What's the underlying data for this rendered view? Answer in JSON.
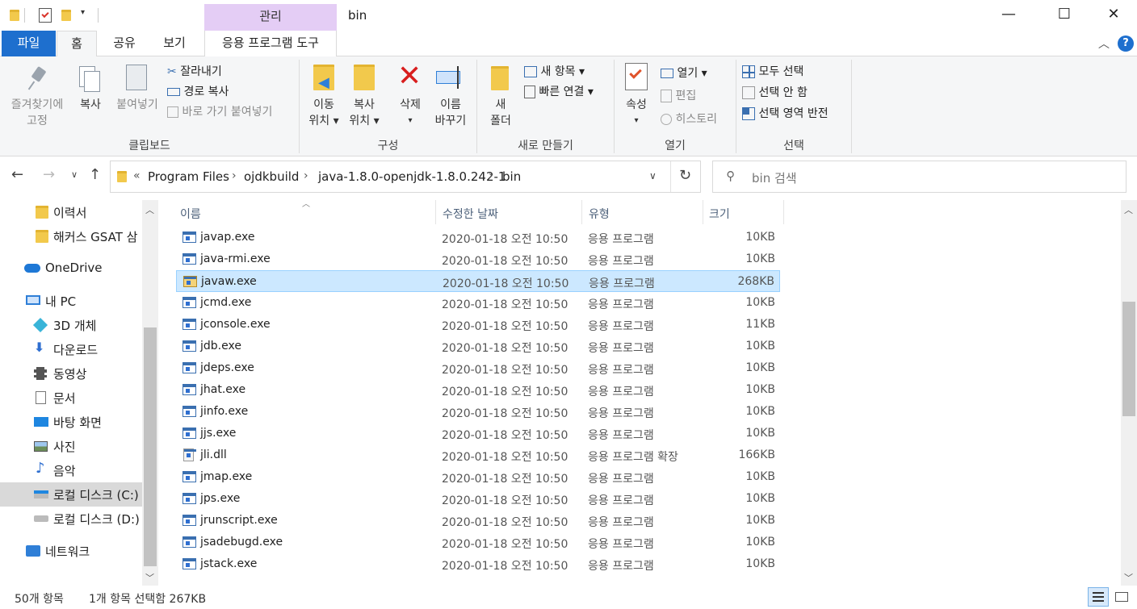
{
  "window": {
    "title": "bin",
    "context_tab": "관리",
    "minimize": "—",
    "maximize": "☐",
    "close": "✕"
  },
  "tabs": {
    "file": "파일",
    "home": "홈",
    "share": "공유",
    "view": "보기",
    "app_tools": "응용 프로그램 도구"
  },
  "ribbon": {
    "clipboard": {
      "label": "클립보드",
      "pin_line1": "즐겨찾기에",
      "pin_line2": "고정",
      "copy": "복사",
      "paste": "붙여넣기",
      "cut": "잘라내기",
      "copy_path": "경로 복사",
      "paste_shortcut": "바로 가기 붙여넣기"
    },
    "organize": {
      "label": "구성",
      "move_line1": "이동",
      "move_line2": "위치",
      "copyto_line1": "복사",
      "copyto_line2": "위치",
      "delete": "삭제",
      "rename_line1": "이름",
      "rename_line2": "바꾸기"
    },
    "new": {
      "label": "새로 만들기",
      "new_folder_line1": "새",
      "new_folder_line2": "폴더",
      "new_item": "새 항목",
      "easy_access": "빠른 연결"
    },
    "open": {
      "label": "열기",
      "properties": "속성",
      "open": "열기",
      "edit": "편집",
      "history": "히스토리"
    },
    "select": {
      "label": "선택",
      "select_all": "모두 선택",
      "select_none": "선택 안 함",
      "invert": "선택 영역 반전"
    }
  },
  "address": {
    "overflow": "«",
    "crumbs": [
      "Program Files",
      "ojdkbuild",
      "java-1.8.0-openjdk-1.8.0.242-1",
      "bin"
    ],
    "search_placeholder": "bin 검색"
  },
  "nav_pane": [
    {
      "label": "이력서",
      "icon": "folder-icon"
    },
    {
      "label": "해커스 GSAT 삼",
      "icon": "folder-icon"
    },
    {
      "label": "OneDrive",
      "icon": "onedrive-icon"
    },
    {
      "label": "내 PC",
      "icon": "pc-icon"
    },
    {
      "label": "3D 개체",
      "icon": "3d-objects-icon"
    },
    {
      "label": "다운로드",
      "icon": "download-icon"
    },
    {
      "label": "동영상",
      "icon": "video-icon"
    },
    {
      "label": "문서",
      "icon": "documents-icon"
    },
    {
      "label": "바탕 화면",
      "icon": "desktop-icon"
    },
    {
      "label": "사진",
      "icon": "pictures-icon"
    },
    {
      "label": "음악",
      "icon": "music-icon"
    },
    {
      "label": "로컬 디스크 (C:)",
      "icon": "drive-c-icon"
    },
    {
      "label": "로컬 디스크 (D:)",
      "icon": "drive-d-icon"
    },
    {
      "label": "네트워크",
      "icon": "network-icon"
    }
  ],
  "columns": {
    "name": "이름",
    "modified": "수정한 날짜",
    "type": "유형",
    "size": "크기"
  },
  "files": [
    {
      "name": "javap.exe",
      "modified": "2020-01-18 오전 10:50",
      "type": "응용 프로그램",
      "size": "10KB"
    },
    {
      "name": "java-rmi.exe",
      "modified": "2020-01-18 오전 10:50",
      "type": "응용 프로그램",
      "size": "10KB"
    },
    {
      "name": "javaw.exe",
      "modified": "2020-01-18 오전 10:50",
      "type": "응용 프로그램",
      "size": "268KB"
    },
    {
      "name": "jcmd.exe",
      "modified": "2020-01-18 오전 10:50",
      "type": "응용 프로그램",
      "size": "10KB"
    },
    {
      "name": "jconsole.exe",
      "modified": "2020-01-18 오전 10:50",
      "type": "응용 프로그램",
      "size": "11KB"
    },
    {
      "name": "jdb.exe",
      "modified": "2020-01-18 오전 10:50",
      "type": "응용 프로그램",
      "size": "10KB"
    },
    {
      "name": "jdeps.exe",
      "modified": "2020-01-18 오전 10:50",
      "type": "응용 프로그램",
      "size": "10KB"
    },
    {
      "name": "jhat.exe",
      "modified": "2020-01-18 오전 10:50",
      "type": "응용 프로그램",
      "size": "10KB"
    },
    {
      "name": "jinfo.exe",
      "modified": "2020-01-18 오전 10:50",
      "type": "응용 프로그램",
      "size": "10KB"
    },
    {
      "name": "jjs.exe",
      "modified": "2020-01-18 오전 10:50",
      "type": "응용 프로그램",
      "size": "10KB"
    },
    {
      "name": "jli.dll",
      "modified": "2020-01-18 오전 10:50",
      "type": "응용 프로그램 확장",
      "size": "166KB"
    },
    {
      "name": "jmap.exe",
      "modified": "2020-01-18 오전 10:50",
      "type": "응용 프로그램",
      "size": "10KB"
    },
    {
      "name": "jps.exe",
      "modified": "2020-01-18 오전 10:50",
      "type": "응용 프로그램",
      "size": "10KB"
    },
    {
      "name": "jrunscript.exe",
      "modified": "2020-01-18 오전 10:50",
      "type": "응용 프로그램",
      "size": "10KB"
    },
    {
      "name": "jsadebugd.exe",
      "modified": "2020-01-18 오전 10:50",
      "type": "응용 프로그램",
      "size": "10KB"
    },
    {
      "name": "jstack.exe",
      "modified": "2020-01-18 오전 10:50",
      "type": "응용 프로그램",
      "size": "10KB"
    }
  ],
  "status": {
    "count": "50개 항목",
    "selection": "1개 항목 선택함 267KB"
  }
}
